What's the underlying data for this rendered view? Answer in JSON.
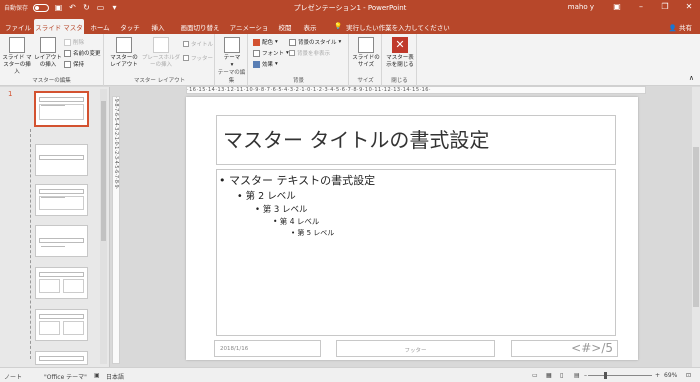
{
  "titlebar": {
    "autosave": "自動保存",
    "autosave_state": "オフ",
    "title": "プレゼンテーション1 - PowerPoint",
    "user": "maho y"
  },
  "tabs": [
    "ファイル",
    "スライド マスター",
    "ホーム",
    "タッチ",
    "挿入",
    "画面切り替え",
    "アニメーション",
    "校閲",
    "表示"
  ],
  "tellme": "実行したい作業を入力してください",
  "share": "共有",
  "ribbon": {
    "master_edit": {
      "insert_master": "スライド マスターの挿入",
      "insert_layout": "レイアウトの挿入",
      "delete": "削除",
      "rename": "名前の変更",
      "preserve": "保持",
      "label": "マスターの編集"
    },
    "master_layout": {
      "master_layout": "マスターのレイアウト",
      "insert_placeholder": "プレースホルダーの挿入",
      "title": "タイトル",
      "footer": "フッター",
      "label": "マスター レイアウト"
    },
    "theme_edit": {
      "themes": "テーマ",
      "label": "テーマの編集"
    },
    "background": {
      "colors": "配色",
      "fonts": "フォント",
      "effects": "効果",
      "bg_styles": "背景のスタイル",
      "hide_bg": "背景を非表示",
      "label": "背景"
    },
    "size": {
      "slide_size": "スライドのサイズ",
      "label": "サイズ"
    },
    "close": {
      "close_master": "マスター表示を閉じる",
      "label": "閉じる"
    }
  },
  "pane": {
    "slide_number": "1"
  },
  "ruler_h": "·16·15·14·13·12·11·10·9·8·7·6·5·4·3·2·1·0·1·2·3·4·5·6·7·8·9·10·11·12·13·14·15·16·",
  "ruler_v": "·9·8·7·6·5·4·3·2·1·0·1·2·3·4·5·6·7·8·9·",
  "slide": {
    "title": "マスター タイトルの書式設定",
    "level1": "• マスター テキストの書式設定",
    "level2": "• 第 2 レベル",
    "level3": "• 第 3 レベル",
    "level4": "• 第 4 レベル",
    "level5": "• 第 5 レベル",
    "date": "2018/1/16",
    "footer": "フッター",
    "number": "<#>/5"
  },
  "status": {
    "view": "ノート",
    "theme": "\"Office テーマ\"",
    "language": "日本語",
    "zoom": "69%"
  },
  "colors": {
    "accent": "#b7472a",
    "selection": "#d35230"
  }
}
